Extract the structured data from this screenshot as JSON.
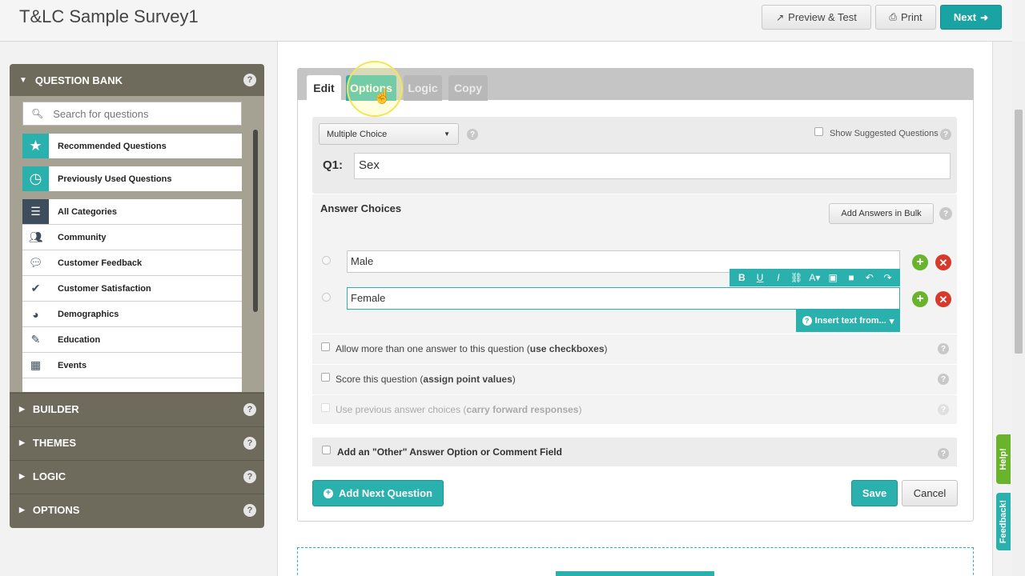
{
  "header": {
    "title": "T&LC Sample Survey1",
    "preview_label": "Preview & Test",
    "print_label": "Print",
    "next_label": "Next"
  },
  "sidebar": {
    "question_bank_label": "QUESTION BANK",
    "search_placeholder": "Search for questions",
    "recommended_label": "Recommended Questions",
    "previously_used_label": "Previously Used Questions",
    "categories": [
      {
        "label": "All Categories",
        "icon": "list-icon"
      },
      {
        "label": "Community",
        "icon": "people-icon"
      },
      {
        "label": "Customer Feedback",
        "icon": "chat-icon"
      },
      {
        "label": "Customer Satisfaction",
        "icon": "check-icon"
      },
      {
        "label": "Demographics",
        "icon": "pie-chart-icon"
      },
      {
        "label": "Education",
        "icon": "pencil-icon"
      },
      {
        "label": "Events",
        "icon": "calendar-icon"
      }
    ],
    "sections": [
      "BUILDER",
      "THEMES",
      "LOGIC",
      "OPTIONS"
    ]
  },
  "editor": {
    "tabs": [
      "Edit",
      "Options",
      "Logic",
      "Copy"
    ],
    "question_type": "Multiple Choice",
    "show_suggested_label": "Show Suggested Questions",
    "question_number": "Q1:",
    "question_text": "Sex",
    "answer_choices_label": "Answer Choices",
    "add_bulk_label": "Add Answers in Bulk",
    "answers": [
      "Male",
      "Female"
    ],
    "insert_text_label": "Insert text from...",
    "options": [
      {
        "text": "Allow more than one answer to this question (",
        "bold": "use checkboxes",
        "tail": ")"
      },
      {
        "text": "Score this question (",
        "bold": "assign point values",
        "tail": ")"
      },
      {
        "text": "Use previous answer choices (",
        "bold": "carry forward responses",
        "tail": ")"
      }
    ],
    "other_label": "Add an \"Other\" Answer Option or Comment Field",
    "add_next_label": "Add Next Question",
    "save_label": "Save",
    "cancel_label": "Cancel"
  },
  "side_tabs": {
    "help_label": "Help!",
    "feedback_label": "Feedback!"
  },
  "colors": {
    "accent": "#2ab0ad",
    "sidebar_bg": "#6e6b5d",
    "add_green": "#6ab42d",
    "delete_red": "#d63a2a"
  }
}
